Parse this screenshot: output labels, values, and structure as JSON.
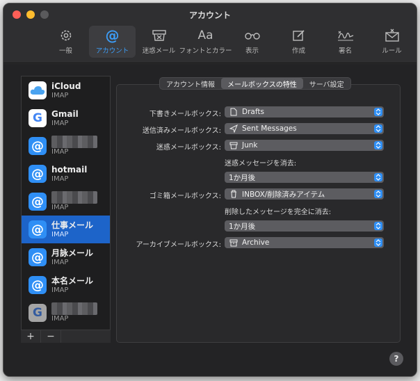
{
  "window": {
    "title": "アカウント"
  },
  "toolbar": {
    "items": [
      {
        "label": "一般",
        "icon": "gear-icon"
      },
      {
        "label": "アカウント",
        "icon": "at-icon",
        "active": true
      },
      {
        "label": "迷惑メール",
        "icon": "junk-icon"
      },
      {
        "label": "フォントとカラー",
        "icon": "fonts-icon",
        "glyph": "Aa"
      },
      {
        "label": "表示",
        "icon": "glasses-icon"
      },
      {
        "label": "作成",
        "icon": "compose-icon"
      },
      {
        "label": "署名",
        "icon": "signature-icon"
      },
      {
        "label": "ルール",
        "icon": "rules-icon"
      }
    ]
  },
  "accounts": [
    {
      "name": "iCloud",
      "type": "IMAP",
      "icon": "icloud-icon"
    },
    {
      "name": "Gmail",
      "type": "IMAP",
      "icon": "gmail-icon"
    },
    {
      "name": "",
      "type": "IMAP",
      "icon": "at-icon",
      "redacted": true
    },
    {
      "name": "hotmail",
      "type": "IMAP",
      "icon": "at-icon"
    },
    {
      "name": "",
      "type": "IMAP",
      "icon": "at-icon",
      "redacted": true
    },
    {
      "name": "仕事メール",
      "type": "IMAP",
      "icon": "at-icon",
      "selected": true
    },
    {
      "name": "月詠メール",
      "type": "IMAP",
      "icon": "at-icon"
    },
    {
      "name": "本名メール",
      "type": "IMAP",
      "icon": "at-icon"
    },
    {
      "name": "",
      "type": "IMAP",
      "icon": "gmail-icon",
      "redacted": true
    }
  ],
  "list_buttons": {
    "add": "+",
    "remove": "−"
  },
  "tabs": [
    {
      "label": "アカウント情報"
    },
    {
      "label": "メールボックスの特性",
      "active": true
    },
    {
      "label": "サーバ設定"
    }
  ],
  "settings": {
    "drafts": {
      "label": "下書きメールボックス:",
      "value": "Drafts",
      "icon": "document-icon"
    },
    "sent": {
      "label": "送信済みメールボックス:",
      "value": "Sent Messages",
      "icon": "paperplane-icon"
    },
    "junk": {
      "label": "迷惑メールボックス:",
      "value": "Junk",
      "icon": "junk-icon"
    },
    "junk_delete": {
      "label": "迷惑メッセージを消去:",
      "value": "1か月後"
    },
    "trash": {
      "label": "ゴミ箱メールボックス:",
      "value": "INBOX/削除済みアイテム",
      "icon": "trash-icon"
    },
    "trash_delete": {
      "label": "削除したメッセージを完全に消去:",
      "value": "1か月後"
    },
    "archive": {
      "label": "アーカイブメールボックス:",
      "value": "Archive",
      "icon": "archive-icon"
    }
  },
  "help": {
    "label": "?"
  },
  "colors": {
    "accent": "#2f8ff5",
    "selected": "#1d64c9",
    "window": "#2b2b2d"
  }
}
